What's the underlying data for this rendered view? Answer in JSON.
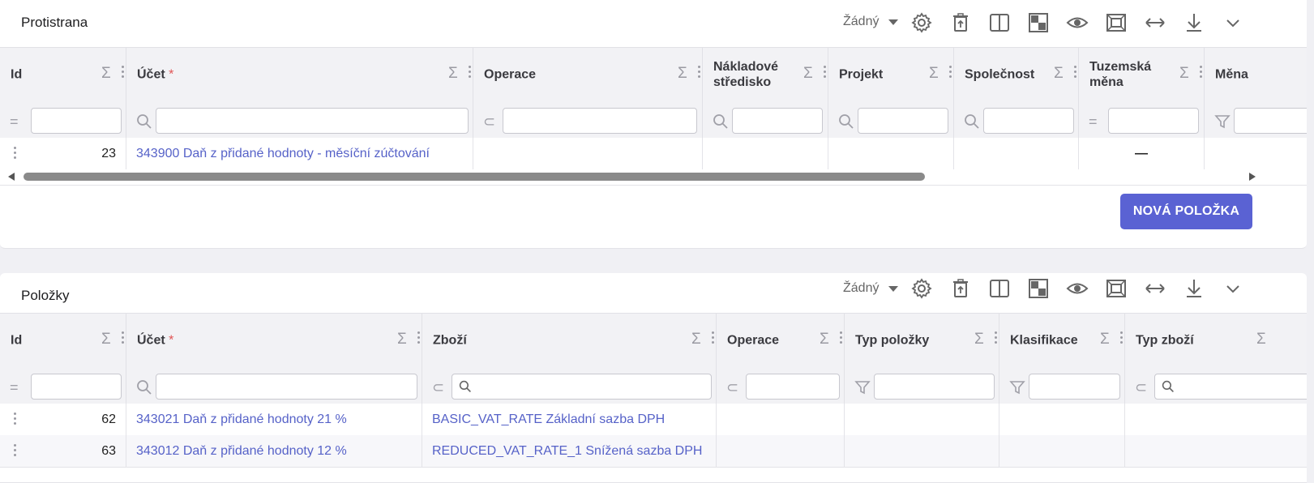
{
  "panel1": {
    "title": "Protistrana",
    "toolbar": {
      "view_select": "Žádný",
      "icons": [
        "gear-icon",
        "delete-icon",
        "columns-icon",
        "density-icon",
        "eye-icon",
        "fit-icon",
        "expand-width-icon",
        "download-icon",
        "chevron-down-icon"
      ]
    },
    "columns": [
      {
        "label": "Id",
        "required": false
      },
      {
        "label": "Účet",
        "required": true
      },
      {
        "label": "Operace",
        "required": false
      },
      {
        "label": "Nákladové středisko",
        "required": false
      },
      {
        "label": "Projekt",
        "required": false
      },
      {
        "label": "Společnost",
        "required": false
      },
      {
        "label": "Tuzemská měna",
        "required": false
      },
      {
        "label": "Měna",
        "required": false
      }
    ],
    "filter_icons": [
      "=",
      "search",
      "⊂",
      "search",
      "search",
      "search",
      "=",
      "filter"
    ],
    "rows": [
      {
        "id": "23",
        "account": "343900 Daň z přidané hodnoty - měsíční zúčtování",
        "operation": "",
        "cost_center": "",
        "project": "",
        "company": "",
        "domestic_currency": "—"
      }
    ],
    "new_button": "NOVÁ POLOŽKA"
  },
  "panel2": {
    "title": "Položky",
    "toolbar": {
      "view_select": "Žádný",
      "icons": [
        "gear-icon",
        "delete-icon",
        "columns-icon",
        "density-icon",
        "eye-icon",
        "fit-icon",
        "expand-width-icon",
        "download-icon",
        "chevron-down-icon"
      ]
    },
    "columns": [
      {
        "label": "Id",
        "required": false
      },
      {
        "label": "Účet",
        "required": true
      },
      {
        "label": "Zboží",
        "required": false
      },
      {
        "label": "Operace",
        "required": false
      },
      {
        "label": "Typ položky",
        "required": false
      },
      {
        "label": "Klasifikace",
        "required": false
      },
      {
        "label": "Typ zboží",
        "required": false
      }
    ],
    "rows": [
      {
        "id": "62",
        "account": "343021 Daň z přidané hodnoty 21 %",
        "goods": "BASIC_VAT_RATE Základní sazba DPH"
      },
      {
        "id": "63",
        "account": "343012 Daň z přidané hodnoty 12 %",
        "goods": "REDUCED_VAT_RATE_1 Snížená sazba DPH"
      }
    ]
  },
  "colors": {
    "accent": "#5a62d3",
    "link": "#5662c8",
    "required": "#e05252"
  }
}
